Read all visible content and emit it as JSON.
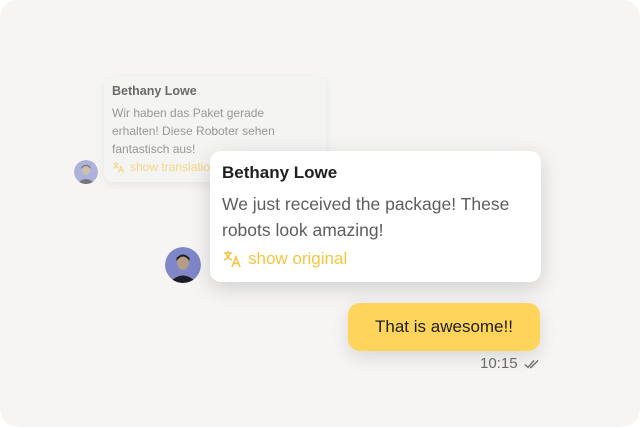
{
  "background_card": {
    "sender": "Bethany Lowe",
    "text": "Wir haben das Paket gerade erhalten! Diese Roboter sehen fantastisch aus!",
    "link": "show translation"
  },
  "foreground_card": {
    "sender": "Bethany Lowe",
    "text": "We just received the package! These robots look amazing!",
    "link": "show original"
  },
  "outgoing": {
    "text": "That is awesome!!",
    "time": "10:15"
  },
  "icons": {
    "translate": "translate-icon",
    "read_receipt": "double-check-icon"
  },
  "colors": {
    "accent": "#f4c542",
    "bubble": "#ffd45a",
    "background": "#f6f5f4"
  }
}
